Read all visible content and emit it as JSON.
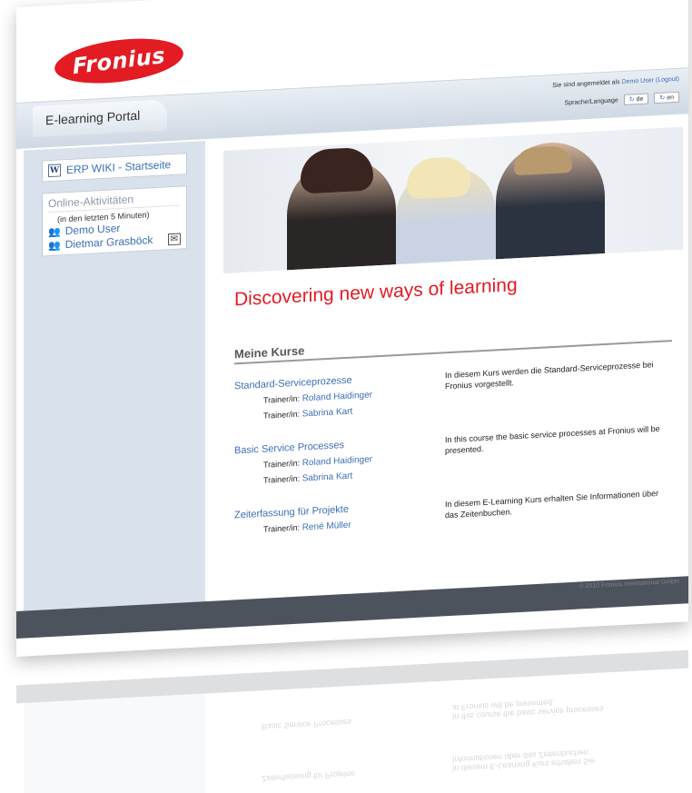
{
  "logo": {
    "text": "Fronius"
  },
  "header": {
    "tab_label": "E-learning Portal",
    "logged_in_prefix": "Sie sind angemeldet als",
    "logged_in_user": "Demo User",
    "logout_label": "(Logout)",
    "language_label": "Sprache/Language",
    "lang_de": "de",
    "lang_en": "en"
  },
  "sidebar": {
    "wiki_link": "ERP WIKI - Startseite",
    "online_title": "Online-Aktivitäten",
    "online_subtitle": "(in den letzten 5 Minuten)",
    "users": [
      "Demo User",
      "Dietmar Grasböck"
    ]
  },
  "main": {
    "headline": "Discovering new ways of learning",
    "section_title": "Meine Kurse",
    "trainer_label": "Trainer/in:",
    "courses": [
      {
        "name": "Standard-Serviceprozesse",
        "trainers": [
          "Roland Haidinger",
          "Sabrina Kart"
        ],
        "description": "In diesem Kurs werden die Standard-Serviceprozesse bei Fronius vorgestellt."
      },
      {
        "name": "Basic Service Processes",
        "trainers": [
          "Roland Haidinger",
          "Sabrina Kart"
        ],
        "description": "In this course the basic service processes at Fronius will be presented."
      },
      {
        "name": "Zeiterfassung für Projekte",
        "trainers": [
          "René Müller"
        ],
        "description": "In diesem E-Learning Kurs erhalten Sie Informationen über das Zeitenbuchen."
      }
    ]
  },
  "footer": {
    "text": "© 2010 Fronius International GmbH"
  },
  "colors": {
    "brand_red": "#e31b23",
    "link_blue": "#3b6fb6",
    "footer_gray": "#4d535c",
    "sidebar_bg": "#d9e2ec"
  }
}
